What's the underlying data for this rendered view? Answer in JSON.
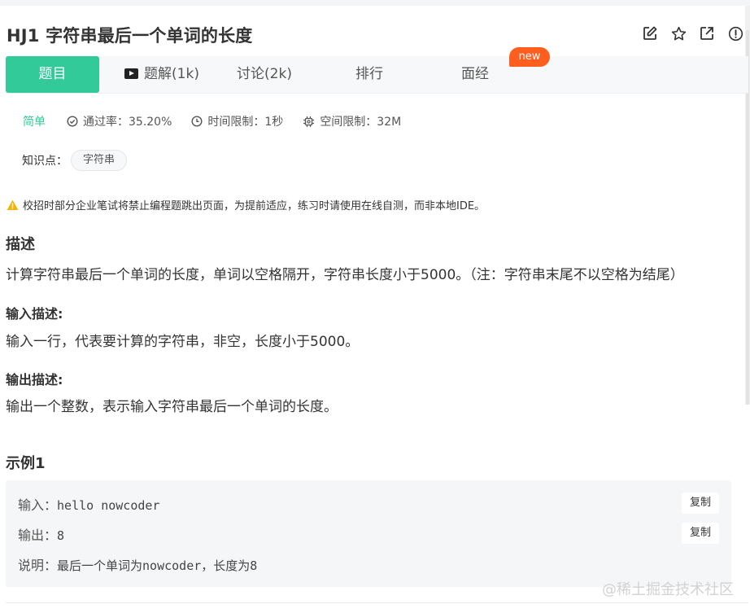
{
  "problem": {
    "title": "HJ1  字符串最后一个单词的长度"
  },
  "title_actions": [
    {
      "icon": "edit-icon"
    },
    {
      "icon": "star-icon"
    },
    {
      "icon": "share-icon"
    },
    {
      "icon": "info-icon"
    }
  ],
  "tabs": {
    "question": "题目",
    "solutions": "题解(1k)",
    "discussion": "讨论(2k)",
    "ranking": "排行",
    "interview": "面经",
    "new_badge": "new",
    "active": "question"
  },
  "meta": {
    "difficulty": "简单",
    "pass_rate": "通过率：35.20%",
    "time_limit": "时间限制：1秒",
    "space_limit": "空间限制：32M"
  },
  "knowledge": {
    "label": "知识点：",
    "tag": "字符串"
  },
  "warning": "校招时部分企业笔试将禁止编程题跳出页面，为提前适应，练习时请使用在线自测，而非本地IDE。",
  "description": {
    "heading": "描述",
    "text": "计算字符串最后一个单词的长度，单词以空格隔开，字符串长度小于5000。（注：字符串末尾不以空格为结尾）"
  },
  "input_desc": {
    "heading": "输入描述:",
    "text": "输入一行，代表要计算的字符串，非空，长度小于5000。"
  },
  "output_desc": {
    "heading": "输出描述:",
    "text": "输出一个整数，表示输入字符串最后一个单词的长度。"
  },
  "example": {
    "heading": "示例1",
    "input_label": "输入：",
    "input_value": "hello nowcoder",
    "output_label": "输出：",
    "output_value": "8",
    "explain_label": "说明：",
    "explain_text": "最后一个单词为nowcoder，长度为8",
    "copy_label": "复制"
  },
  "watermark": "@稀土掘金技术社区",
  "colors": {
    "accent": "#32ca99",
    "badge": "#ff5e1f",
    "warning": "#f5b400"
  }
}
